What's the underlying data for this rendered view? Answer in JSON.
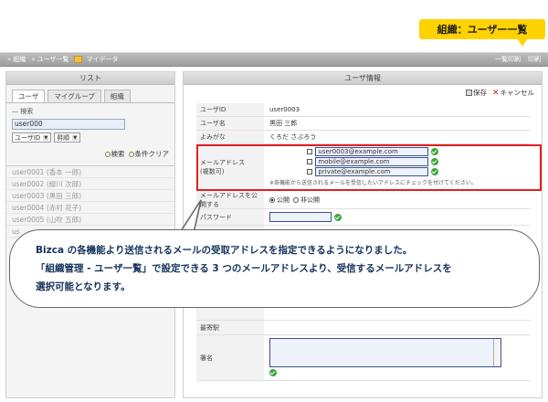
{
  "badge": {
    "label": "組織：ユーザー一覧"
  },
  "titlebar": {
    "crumbs": [
      "組織",
      "ユーザ一覧"
    ],
    "my_data": "マイデータ",
    "print_list": "一覧印刷",
    "print": "印刷"
  },
  "left": {
    "header": "リスト",
    "tabs": [
      "ユーザ",
      "マイグループ",
      "組織"
    ],
    "search_title": "検索",
    "search_value": "user000",
    "select_field": "ユーザID",
    "select_order": "昇順",
    "search_button": "検索",
    "clear_button": "条件クリア",
    "users": [
      "user0001 (香本 一郎)",
      "user0002 (緑川 次郎)",
      "user0003 (黒田 三郎)",
      "user0004 (赤村 花子)",
      "user0005 (山吹 五郎)",
      "us"
    ]
  },
  "right": {
    "header": "ユーザ情報",
    "save": "保存",
    "cancel": "キャンセル",
    "rows": {
      "user_id": {
        "label": "ユーザID",
        "value": "user0003"
      },
      "user_name": {
        "label": "ユーザ名",
        "value": "黒田 三郎"
      },
      "reading": {
        "label": "よみがな",
        "value": "くろだ さぶろう"
      },
      "mail": {
        "label": "メールアドレス",
        "sublabel": "(複数可)",
        "addresses": [
          "user0003@example.com",
          "mobile@example.com",
          "private@example.com"
        ],
        "note": "※各機能から送信されるメールを受信したいアドレスにチェックを付けてください。"
      },
      "publish": {
        "label": "メールアドレスを公開する",
        "public": "公開",
        "private": "非公開"
      },
      "password": {
        "label": "パスワード"
      },
      "station": {
        "label": "最寄駅"
      },
      "signature": {
        "label": "署名"
      }
    }
  },
  "callout": {
    "line1": "Bizca の各機能より送信されるメールの受取アドレスを指定できるようになりました。",
    "line2": "「組織管理 - ユーザ一覧」で設定できる 3 つのメールアドレスより、受信するメールアドレスを",
    "line3": "選択可能となります。"
  }
}
